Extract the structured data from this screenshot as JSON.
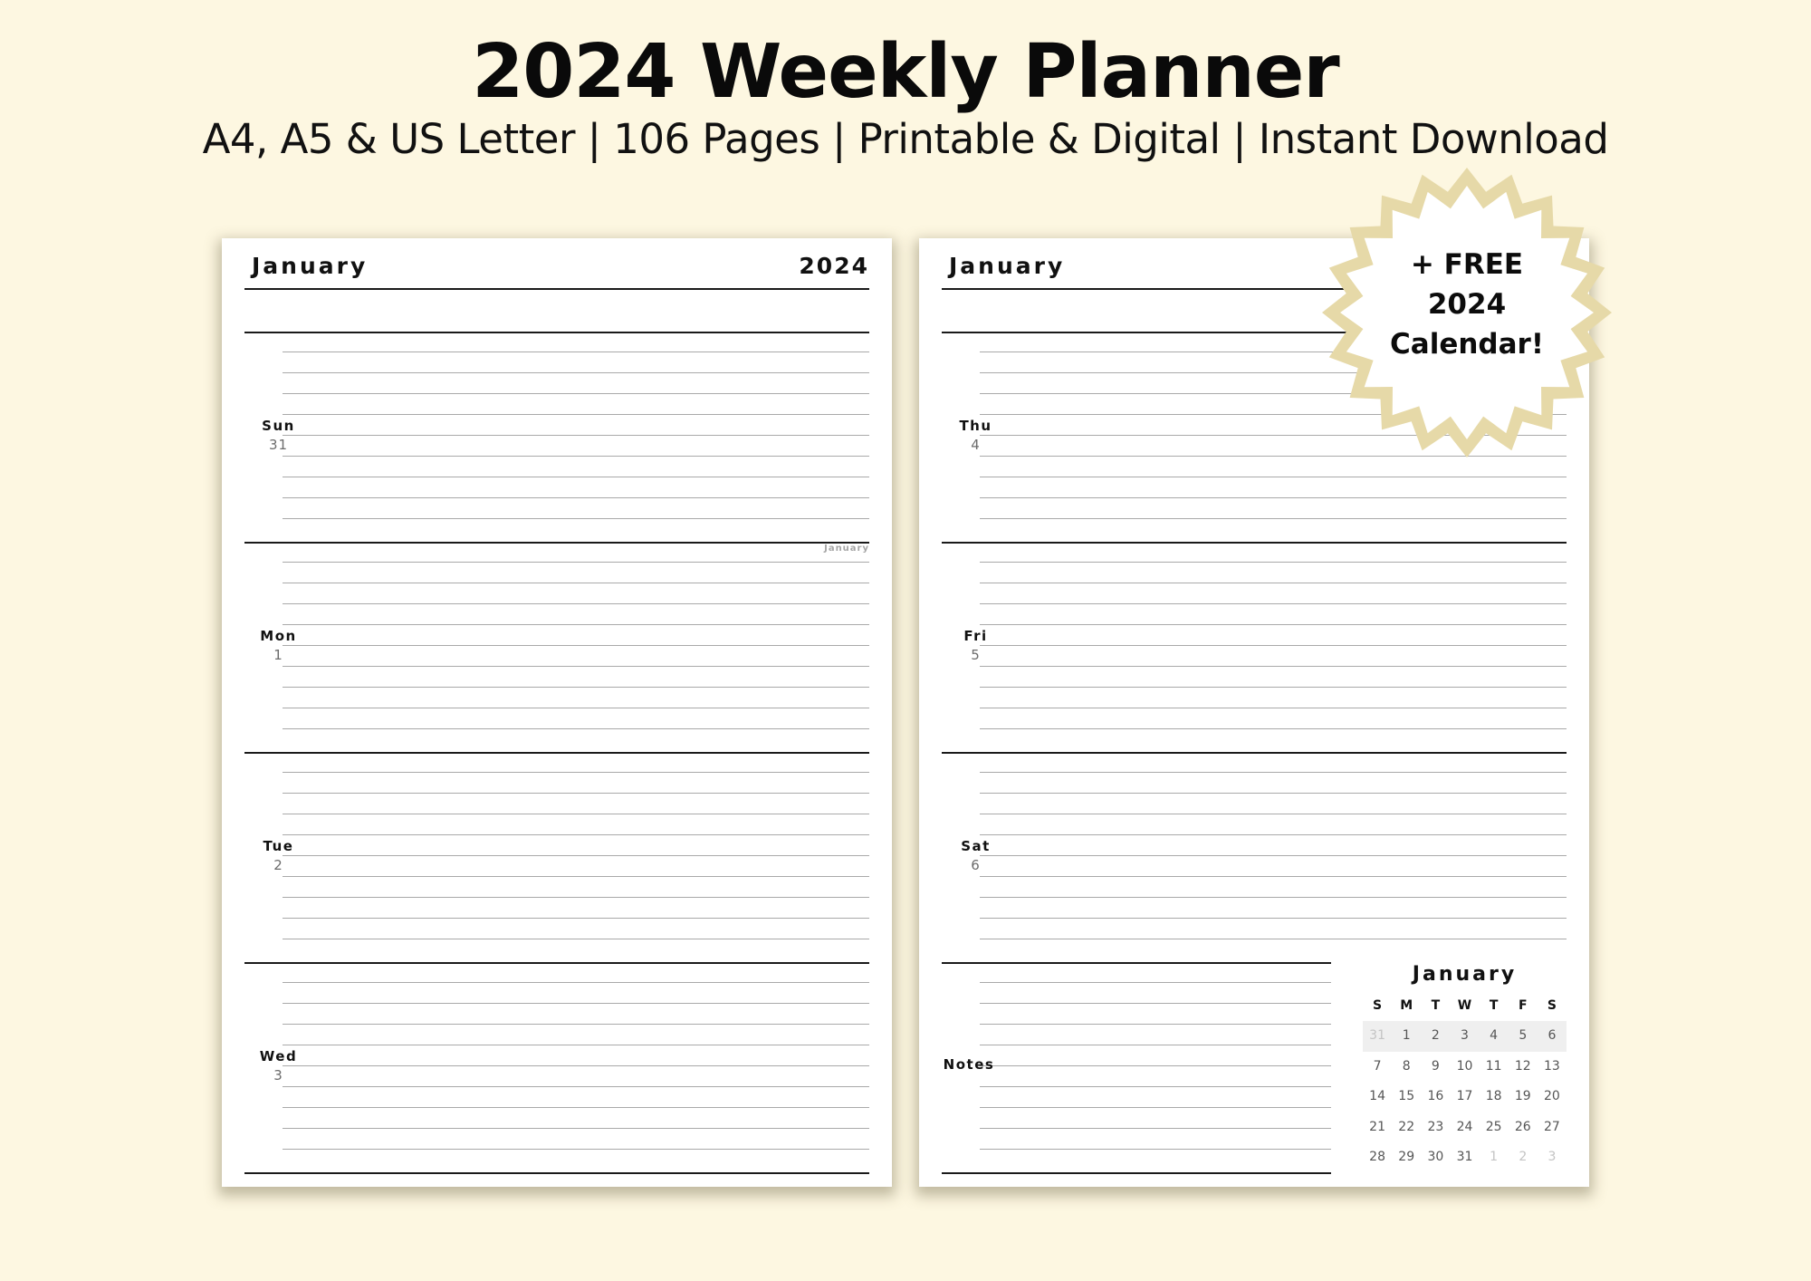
{
  "header": {
    "title": "2024 Weekly Planner",
    "subtitle": "A4, A5 & US Letter | 106 Pages | Printable & Digital | Instant Download"
  },
  "colors": {
    "background": "#fdf7e1",
    "badge_star": "#e6d9a8",
    "page": "#ffffff",
    "thick_rule": "#1a1a1a",
    "thin_rule": "#a9a9a9"
  },
  "left_page": {
    "month": "January",
    "year": "2024",
    "next_month_tag": "January",
    "days": [
      {
        "name": "Sun",
        "num": "31"
      },
      {
        "name": "Mon",
        "num": "1"
      },
      {
        "name": "Tue",
        "num": "2"
      },
      {
        "name": "Wed",
        "num": "3"
      }
    ]
  },
  "right_page": {
    "month": "January",
    "days": [
      {
        "name": "Thu",
        "num": "4"
      },
      {
        "name": "Fri",
        "num": "5"
      },
      {
        "name": "Sat",
        "num": "6"
      }
    ],
    "notes_label": "Notes",
    "mini_calendar": {
      "title": "January",
      "weekdays": [
        "S",
        "M",
        "T",
        "W",
        "T",
        "F",
        "S"
      ],
      "weeks": [
        [
          {
            "d": "31",
            "muted": true
          },
          {
            "d": "1"
          },
          {
            "d": "2"
          },
          {
            "d": "3"
          },
          {
            "d": "4"
          },
          {
            "d": "5"
          },
          {
            "d": "6"
          }
        ],
        [
          {
            "d": "7"
          },
          {
            "d": "8"
          },
          {
            "d": "9"
          },
          {
            "d": "10"
          },
          {
            "d": "11"
          },
          {
            "d": "12"
          },
          {
            "d": "13"
          }
        ],
        [
          {
            "d": "14"
          },
          {
            "d": "15"
          },
          {
            "d": "16"
          },
          {
            "d": "17"
          },
          {
            "d": "18"
          },
          {
            "d": "19"
          },
          {
            "d": "20"
          }
        ],
        [
          {
            "d": "21"
          },
          {
            "d": "22"
          },
          {
            "d": "23"
          },
          {
            "d": "24"
          },
          {
            "d": "25"
          },
          {
            "d": "26"
          },
          {
            "d": "27"
          }
        ],
        [
          {
            "d": "28"
          },
          {
            "d": "29"
          },
          {
            "d": "30"
          },
          {
            "d": "31"
          },
          {
            "d": "1",
            "muted": true
          },
          {
            "d": "2",
            "muted": true
          },
          {
            "d": "3",
            "muted": true
          }
        ]
      ],
      "highlighted_week": 0
    }
  },
  "badge": {
    "lines": [
      "+ FREE",
      "2024",
      "Calendar!"
    ]
  }
}
